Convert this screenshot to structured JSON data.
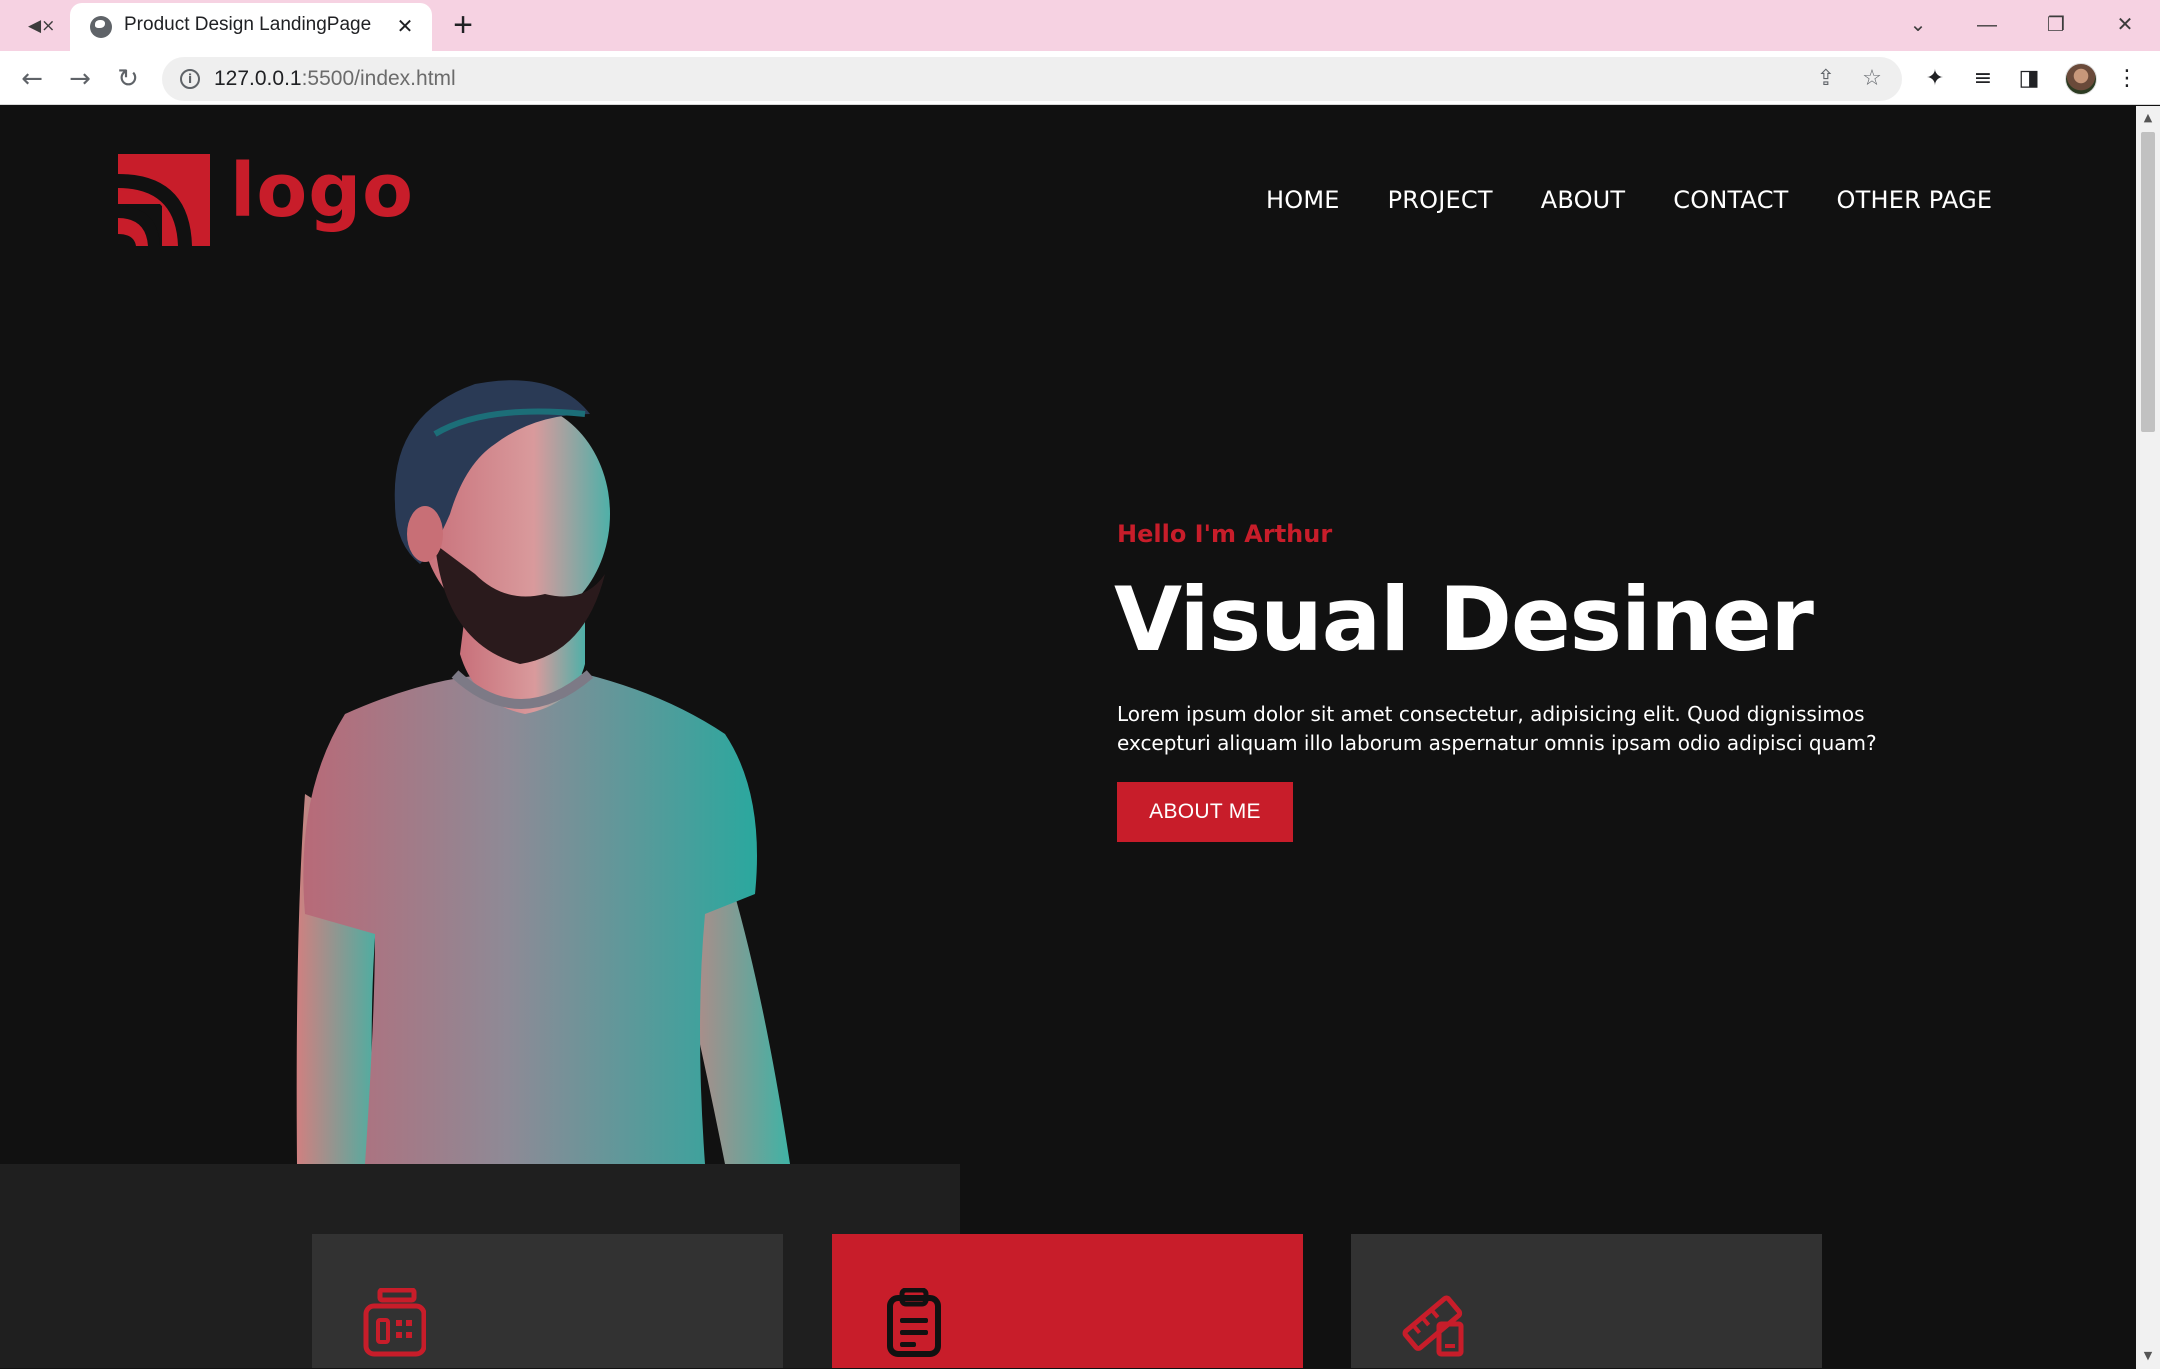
{
  "browser": {
    "tab_title": "Product Design LandingPage",
    "new_tab_symbol": "+",
    "url_host": "127.0.0.1",
    "url_rest": ":5500/index.html"
  },
  "site": {
    "logo_text": "logo",
    "nav": [
      "HOME",
      "PROJECT",
      "ABOUT",
      "CONTACT",
      "OTHER PAGE"
    ],
    "hero": {
      "greeting": "Hello I'm Arthur",
      "title": "Visual Desiner",
      "description": "Lorem ipsum dolor sit amet consectetur, adipisicing elit. Quod dignissimos excepturi aliquam illo laborum aspernatur omnis ipsam odio adipisci quam?",
      "cta_label": "ABOUT ME"
    },
    "services": [
      {
        "icon": "fax-machine-icon"
      },
      {
        "icon": "clipboard-icon"
      },
      {
        "icon": "ruler-pencil-icon"
      }
    ]
  },
  "colors": {
    "accent": "#c81d2a",
    "background": "#111111",
    "panel": "#1f1f1f",
    "card": "#323232",
    "tabbar": "#f6d2e2"
  }
}
